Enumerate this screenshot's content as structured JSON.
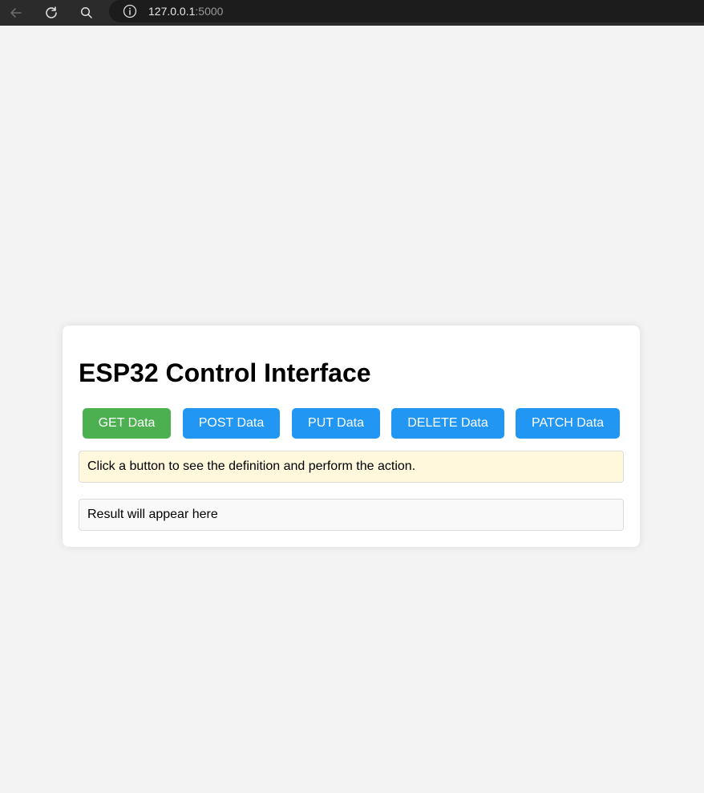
{
  "browser": {
    "url_host": "127.0.0.1",
    "url_port": ":5000",
    "icons": [
      "back-arrow-icon",
      "reload-icon",
      "search-icon",
      "info-icon"
    ]
  },
  "page": {
    "title": "ESP32 Control Interface",
    "buttons": [
      {
        "label": "GET Data",
        "color": "#4caf50"
      },
      {
        "label": "POST Data",
        "color": "#2196f3"
      },
      {
        "label": "PUT Data",
        "color": "#2196f3"
      },
      {
        "label": "DELETE Data",
        "color": "#2196f3"
      },
      {
        "label": "PATCH Data",
        "color": "#2196f3"
      }
    ],
    "definition_text": "Click a button to see the definition and perform the action.",
    "result_text": "Result will appear here"
  },
  "colors": {
    "background": "#f3f3f3",
    "card": "#ffffff",
    "definition_bg": "#fff8dc",
    "result_bg": "#f9f9f9"
  }
}
